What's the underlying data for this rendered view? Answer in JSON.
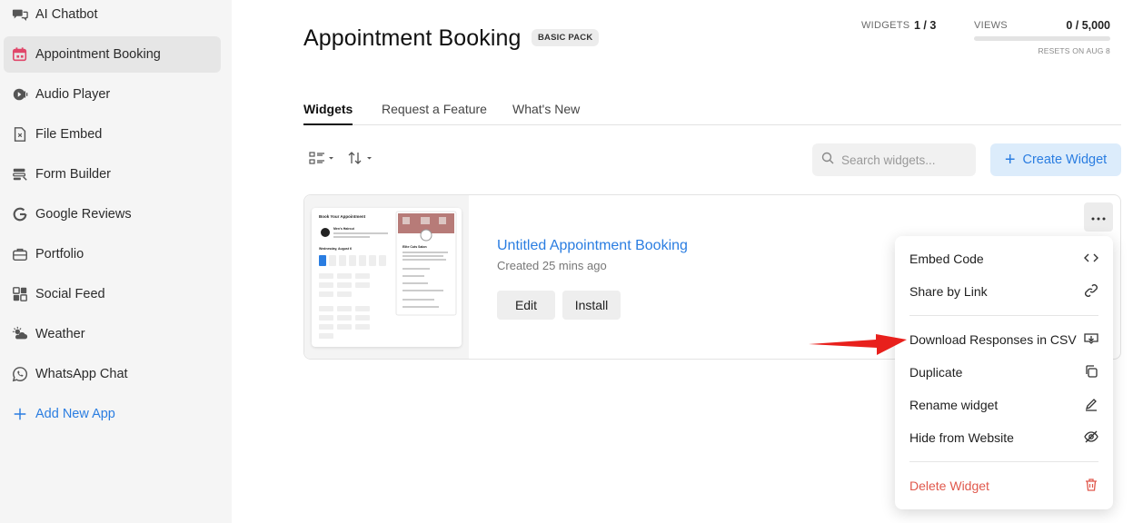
{
  "sidebar": {
    "items": [
      {
        "label": "AI Chatbot",
        "icon": "chat-bubbles-icon"
      },
      {
        "label": "Appointment Booking",
        "icon": "calendar-icon",
        "active": true
      },
      {
        "label": "Audio Player",
        "icon": "audio-player-icon"
      },
      {
        "label": "File Embed",
        "icon": "file-icon"
      },
      {
        "label": "Form Builder",
        "icon": "form-icon"
      },
      {
        "label": "Google Reviews",
        "icon": "google-icon"
      },
      {
        "label": "Portfolio",
        "icon": "briefcase-icon"
      },
      {
        "label": "Social Feed",
        "icon": "grid-icon"
      },
      {
        "label": "Weather",
        "icon": "weather-icon"
      },
      {
        "label": "WhatsApp Chat",
        "icon": "whatsapp-icon"
      }
    ],
    "add_label": "Add New App"
  },
  "header": {
    "title": "Appointment Booking",
    "badge": "BASIC PACK",
    "widgets_label": "WIDGETS",
    "widgets_value": "1 / 3",
    "views_label": "VIEWS",
    "views_value": "0 / 5,000",
    "views_progress": 0,
    "resets_text": "RESETS ON AUG 8"
  },
  "tabs": [
    {
      "label": "Widgets",
      "active": true
    },
    {
      "label": "Request a Feature"
    },
    {
      "label": "What's New"
    }
  ],
  "toolbar": {
    "search_placeholder": "Search widgets...",
    "create_label": "Create Widget"
  },
  "widget": {
    "title": "Untitled Appointment Booking",
    "created": "Created 25 mins ago",
    "edit_label": "Edit",
    "install_label": "Install",
    "preview": {
      "heading": "Book Your Appointment",
      "service_name": "Men's Haircut",
      "date_label": "Wednesday, August 6",
      "business_name": "Elite Cuts Salon"
    }
  },
  "menu": {
    "items": [
      {
        "label": "Embed Code",
        "icon": "code-icon"
      },
      {
        "label": "Share by Link",
        "icon": "link-icon"
      },
      {
        "label": "Download Responses in CSV",
        "icon": "download-csv-icon"
      },
      {
        "label": "Duplicate",
        "icon": "duplicate-icon"
      },
      {
        "label": "Rename widget",
        "icon": "pencil-icon"
      },
      {
        "label": "Hide from Website",
        "icon": "eye-off-icon"
      },
      {
        "label": "Delete Widget",
        "icon": "trash-icon"
      }
    ]
  },
  "colors": {
    "accent": "#2a7de1",
    "danger": "#e0584c",
    "annotation_arrow": "#e8201c"
  }
}
